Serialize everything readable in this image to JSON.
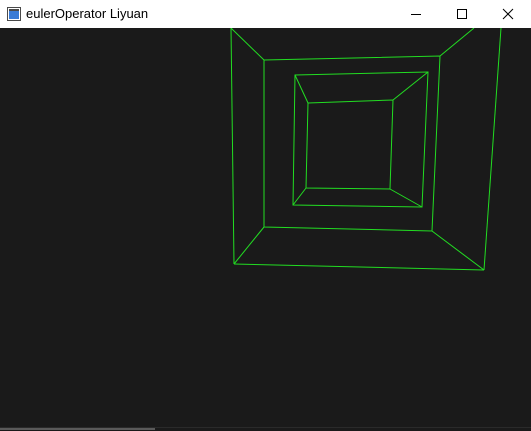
{
  "window": {
    "title": "eulerOperator Liyuan",
    "icon": "app-window-icon",
    "controls": {
      "minimize": "minimize-icon",
      "maximize": "maximize-icon",
      "close": "close-icon"
    }
  },
  "scene": {
    "background_color": "#1a1a1a",
    "wire_color": "#22dd22",
    "description_icon": "wireframe-model"
  }
}
